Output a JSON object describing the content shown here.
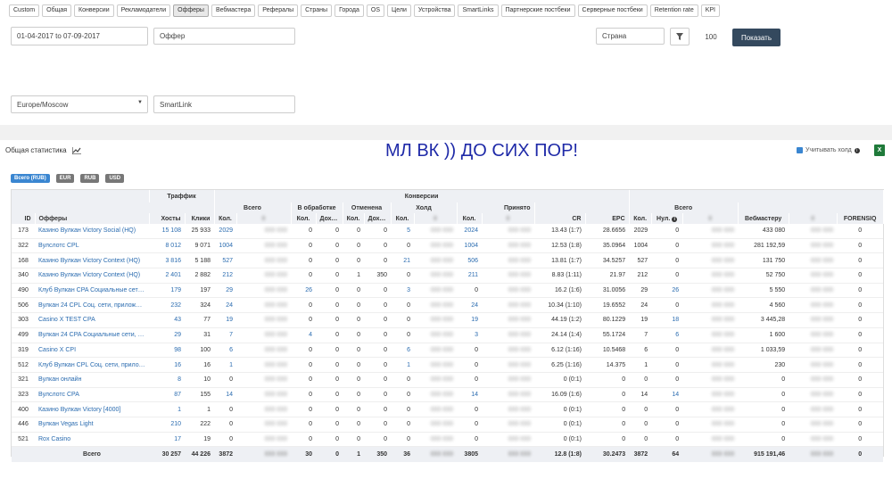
{
  "tabs": [
    "Custom",
    "Общая",
    "Конверсии",
    "Рекламодатели",
    "Офферы",
    "Вебмастера",
    "Рефералы",
    "Страны",
    "Города",
    "OS",
    "Цели",
    "Устройства",
    "SmartLinks",
    "Партнерские постбеки",
    "Серверные постбеки",
    "Retention rate",
    "KPI"
  ],
  "active_tab": "Офферы",
  "filters": {
    "date_range": "01-04-2017 to 07-09-2017",
    "offer_placeholder": "Оффер",
    "country_placeholder": "Страна",
    "filter_icon": "funnel-icon",
    "limit": "100",
    "show_button": "Показать",
    "timezone": "Europe/Moscow",
    "smartlink_placeholder": "SmartLink"
  },
  "section_title": "Общая статистика",
  "chart_icon": "chart-line-icon",
  "banner_text": "МЛ ВК )) ДО СИХ ПОР!",
  "hold_label": "Учитывать холд",
  "excel_icon": "excel-icon",
  "currencies": [
    "Всего (RUB)",
    "EUR",
    "RUB",
    "USD"
  ],
  "active_currency": "Всего (RUB)",
  "table": {
    "group_headers": {
      "traffic": "Траффик",
      "conversions": "Конверсии",
      "total": "Всего",
      "in_progress": "В обработке",
      "cancelled": "Отменена",
      "hold": "Холд",
      "accepted": "Принято",
      "total2": "Всего"
    },
    "headers": {
      "id": "ID",
      "offers": "Офферы",
      "hosts": "Хосты",
      "clicks": "Клики",
      "qty": "Кол.",
      "income": "Доход",
      "cr": "CR",
      "epc": "EPC",
      "zero": "Нул.",
      "webmaster": "Вебмастеру",
      "forensiq": "FORENSIQ"
    },
    "rows": [
      {
        "id": "173",
        "offer": "Казино Вулкан Victory Social (HQ)",
        "hosts": "15 108",
        "clicks": "25 933",
        "total": "2029",
        "proc": "0",
        "proc_inc": "0",
        "canc": "0",
        "canc_inc": "0",
        "hold": "5",
        "acc": "2024",
        "cr": "13.43 (1:7)",
        "epc": "28.6656",
        "q2": "2029",
        "zero": "0",
        "web": "433 080"
      },
      {
        "id": "322",
        "offer": "Вулслотс CPL",
        "hosts": "8 012",
        "clicks": "9 071",
        "total": "1004",
        "proc": "0",
        "proc_inc": "0",
        "canc": "0",
        "canc_inc": "0",
        "hold": "0",
        "acc": "1004",
        "cr": "12.53 (1:8)",
        "epc": "35.0964",
        "q2": "1004",
        "zero": "0",
        "web": "281 192,59"
      },
      {
        "id": "168",
        "offer": "Казино Вулкан Victory Context (HQ)",
        "hosts": "3 816",
        "clicks": "5 188",
        "total": "527",
        "proc": "0",
        "proc_inc": "0",
        "canc": "0",
        "canc_inc": "0",
        "hold": "21",
        "acc": "506",
        "cr": "13.81 (1:7)",
        "epc": "34.5257",
        "q2": "527",
        "zero": "0",
        "web": "131 750"
      },
      {
        "id": "340",
        "offer": "Казино Вулкан Victory Context (HQ)",
        "hosts": "2 401",
        "clicks": "2 882",
        "total": "212",
        "proc": "0",
        "proc_inc": "0",
        "canc": "1",
        "canc_inc": "350",
        "hold": "0",
        "acc": "211",
        "cr": "8.83 (1:11)",
        "epc": "21.97",
        "q2": "212",
        "zero": "0",
        "web": "52 750"
      },
      {
        "id": "490",
        "offer": "Клуб Вулкан CPA Социальные сети, Пр...",
        "hosts": "179",
        "clicks": "197",
        "total": "29",
        "proc": "26",
        "proc_inc": "0",
        "canc": "0",
        "canc_inc": "0",
        "hold": "3",
        "acc": "0",
        "cr": "16.2 (1:6)",
        "epc": "31.0056",
        "q2": "29",
        "zero": "26",
        "web": "5 550"
      },
      {
        "id": "506",
        "offer": "Вулкан 24 CPL Соц. сети, приложения (...",
        "hosts": "232",
        "clicks": "324",
        "total": "24",
        "proc": "0",
        "proc_inc": "0",
        "canc": "0",
        "canc_inc": "0",
        "hold": "0",
        "acc": "24",
        "cr": "10.34 (1:10)",
        "epc": "19.6552",
        "q2": "24",
        "zero": "0",
        "web": "4 560"
      },
      {
        "id": "303",
        "offer": "Casino X TEST CPA",
        "hosts": "43",
        "clicks": "77",
        "total": "19",
        "proc": "0",
        "proc_inc": "0",
        "canc": "0",
        "canc_inc": "0",
        "hold": "0",
        "acc": "19",
        "cr": "44.19 (1:2)",
        "epc": "80.1229",
        "q2": "19",
        "zero": "18",
        "web": "3 445,28"
      },
      {
        "id": "499",
        "offer": "Вулкан 24 CPA Социальные сети, Прил...",
        "hosts": "29",
        "clicks": "31",
        "total": "7",
        "proc": "4",
        "proc_inc": "0",
        "canc": "0",
        "canc_inc": "0",
        "hold": "0",
        "acc": "3",
        "cr": "24.14 (1:4)",
        "epc": "55.1724",
        "q2": "7",
        "zero": "6",
        "web": "1 600"
      },
      {
        "id": "319",
        "offer": "Casino X CPI",
        "hosts": "98",
        "clicks": "100",
        "total": "6",
        "proc": "0",
        "proc_inc": "0",
        "canc": "0",
        "canc_inc": "0",
        "hold": "6",
        "acc": "0",
        "cr": "6.12 (1:16)",
        "epc": "10.5468",
        "q2": "6",
        "zero": "0",
        "web": "1 033,59"
      },
      {
        "id": "512",
        "offer": "Клуб Вулкан CPL Соц. сети, приложени...",
        "hosts": "16",
        "clicks": "16",
        "total": "1",
        "proc": "0",
        "proc_inc": "0",
        "canc": "0",
        "canc_inc": "0",
        "hold": "1",
        "acc": "0",
        "cr": "6.25 (1:16)",
        "epc": "14.375",
        "q2": "1",
        "zero": "0",
        "web": "230"
      },
      {
        "id": "321",
        "offer": "Вулкан онлайн",
        "hosts": "8",
        "clicks": "10",
        "total": "0",
        "proc": "0",
        "proc_inc": "0",
        "canc": "0",
        "canc_inc": "0",
        "hold": "0",
        "acc": "0",
        "cr": "0 (0:1)",
        "epc": "0",
        "q2": "0",
        "zero": "0",
        "web": "0"
      },
      {
        "id": "323",
        "offer": "Вулслотс CPA",
        "hosts": "87",
        "clicks": "155",
        "total": "14",
        "proc": "0",
        "proc_inc": "0",
        "canc": "0",
        "canc_inc": "0",
        "hold": "0",
        "acc": "14",
        "cr": "16.09 (1:6)",
        "epc": "0",
        "q2": "14",
        "zero": "14",
        "web": "0"
      },
      {
        "id": "400",
        "offer": "Казино Вулкан Victory [4000]",
        "hosts": "1",
        "clicks": "1",
        "total": "0",
        "proc": "0",
        "proc_inc": "0",
        "canc": "0",
        "canc_inc": "0",
        "hold": "0",
        "acc": "0",
        "cr": "0 (0:1)",
        "epc": "0",
        "q2": "0",
        "zero": "0",
        "web": "0"
      },
      {
        "id": "446",
        "offer": "Вулкан Vegas Light",
        "hosts": "210",
        "clicks": "222",
        "total": "0",
        "proc": "0",
        "proc_inc": "0",
        "canc": "0",
        "canc_inc": "0",
        "hold": "0",
        "acc": "0",
        "cr": "0 (0:1)",
        "epc": "0",
        "q2": "0",
        "zero": "0",
        "web": "0"
      },
      {
        "id": "521",
        "offer": "Rox Casino",
        "hosts": "17",
        "clicks": "19",
        "total": "0",
        "proc": "0",
        "proc_inc": "0",
        "canc": "0",
        "canc_inc": "0",
        "hold": "0",
        "acc": "0",
        "cr": "0 (0:1)",
        "epc": "0",
        "q2": "0",
        "zero": "0",
        "web": "0"
      }
    ],
    "footer": {
      "label": "Всего",
      "hosts": "30 257",
      "clicks": "44 226",
      "total": "3872",
      "proc": "30",
      "proc_inc": "0",
      "canc": "1",
      "canc_inc": "350",
      "hold": "36",
      "acc": "3805",
      "cr": "12.8 (1:8)",
      "epc": "30.2473",
      "q2": "3872",
      "zero": "64",
      "web": "915 191,46",
      "fq": "0"
    }
  }
}
